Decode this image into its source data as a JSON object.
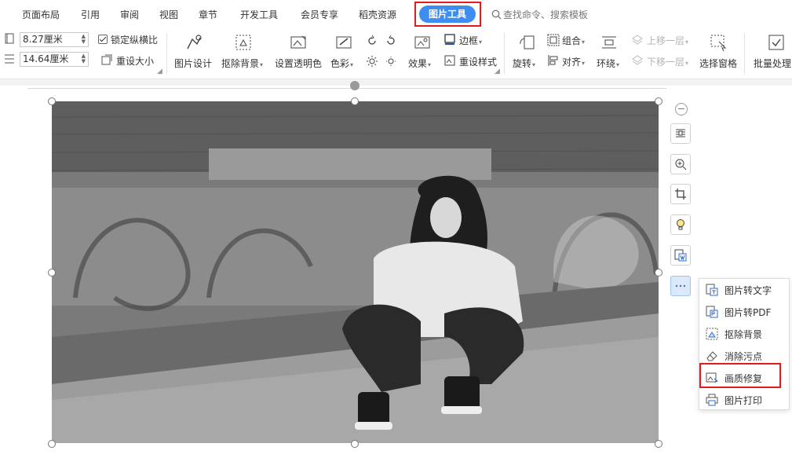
{
  "menu": {
    "tabs": [
      "页面布局",
      "引用",
      "审阅",
      "视图",
      "章节",
      "开发工具",
      "会员专享",
      "稻壳资源"
    ],
    "active_tab": "图片工具",
    "search_placeholder": "查找命令、搜索模板"
  },
  "size": {
    "width_value": "8.27厘米",
    "height_value": "14.64厘米",
    "lock_ratio_label": "锁定纵横比",
    "lock_ratio_checked": true,
    "reset_size_label": "重设大小"
  },
  "ribbon": {
    "picture_design": "图片设计",
    "remove_bg": "抠除背景",
    "set_transparent": "设置透明色",
    "color": "色彩",
    "effects": "效果",
    "border": "边框",
    "reset_style": "重设样式",
    "rotate": "旋转",
    "group": "组合",
    "align": "对齐",
    "wrap": "环绕",
    "bring_forward": "上移一层",
    "send_backward": "下移一层",
    "selection_pane": "选择窗格",
    "batch": "批量处理"
  },
  "float_toolbar": {
    "icons": [
      "zoom-out-icon",
      "layout-icon",
      "zoom-in-icon",
      "crop-icon",
      "idea-icon",
      "image-to-word-icon",
      "more-icon"
    ]
  },
  "popup_menu": {
    "items": [
      "图片转文字",
      "图片转PDF",
      "抠除背景",
      "消除污点",
      "画质修复",
      "图片打印"
    ],
    "highlighted": "画质修复"
  },
  "colors": {
    "accent": "#3d8ef0",
    "highlight_box": "#e41b1b"
  }
}
